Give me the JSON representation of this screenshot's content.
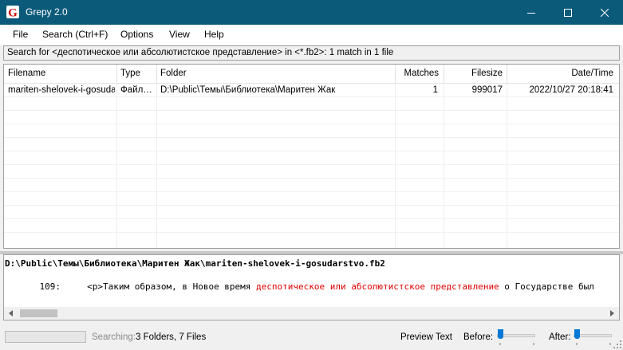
{
  "window": {
    "title": "Grepy 2.0",
    "app_icon": "grepy-g-icon",
    "accent_color": "#0b5a7a"
  },
  "menu": {
    "file": "File",
    "search": "Search (Ctrl+F)",
    "options": "Options",
    "view": "View",
    "help": "Help"
  },
  "search_status": "Search for <деспотическое или абсолютистское представление> in <*.fb2>: 1 match in 1 file",
  "table": {
    "columns": [
      "Filename",
      "Type",
      "Folder",
      "Matches",
      "Filesize",
      "Date/Time"
    ],
    "rows": [
      {
        "filename": "mariten-shelovek-i-gosuda…",
        "type": "Файл…",
        "folder": "D:\\Public\\Темы\\Библиотека\\Маритен Жак",
        "matches": "1",
        "filesize": "999017",
        "datetime": "2022/10/27 20:18:41"
      }
    ]
  },
  "preview": {
    "path": "D:\\Public\\Темы\\Библиотека\\Маритен Жак\\mariten-shelovek-i-gosudarstvo.fb2",
    "line_number": "109:",
    "before": "<p>Таким образом, в Новое время ",
    "match": "деспотическое или абсолютистское представление",
    "after": " о Государстве был",
    "highlight_color": "#e00000"
  },
  "status": {
    "searching_label": "Searching:",
    "searching_value": "3 Folders,  7 Files",
    "preview_text_label": "Preview Text",
    "before_label": "Before:",
    "after_label": "After:",
    "before_level": 0,
    "after_level": 0
  }
}
